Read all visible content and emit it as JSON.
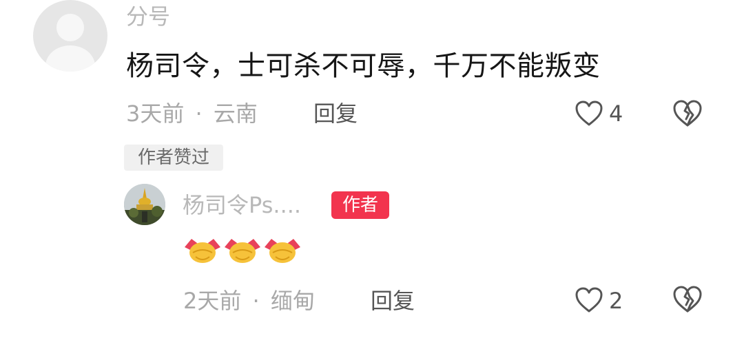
{
  "comment": {
    "username": "分号",
    "text": "杨司令，士可杀不可辱，千万不能叛变",
    "time": "3天前",
    "separator": "·",
    "location": "云南",
    "reply_label": "回复",
    "like_count": "4",
    "author_liked_label": "作者赞过"
  },
  "reply": {
    "username": "杨司令Ps....",
    "author_badge": "作者",
    "emoji_glyphs": [
      "handshake",
      "handshake",
      "handshake"
    ],
    "time": "2天前",
    "separator": "·",
    "location": "缅甸",
    "reply_label": "回复",
    "like_count": "2"
  },
  "colors": {
    "author_badge_bg": "#f2344e",
    "meta_text": "#a8a8a8",
    "icon_stroke": "#555555"
  }
}
